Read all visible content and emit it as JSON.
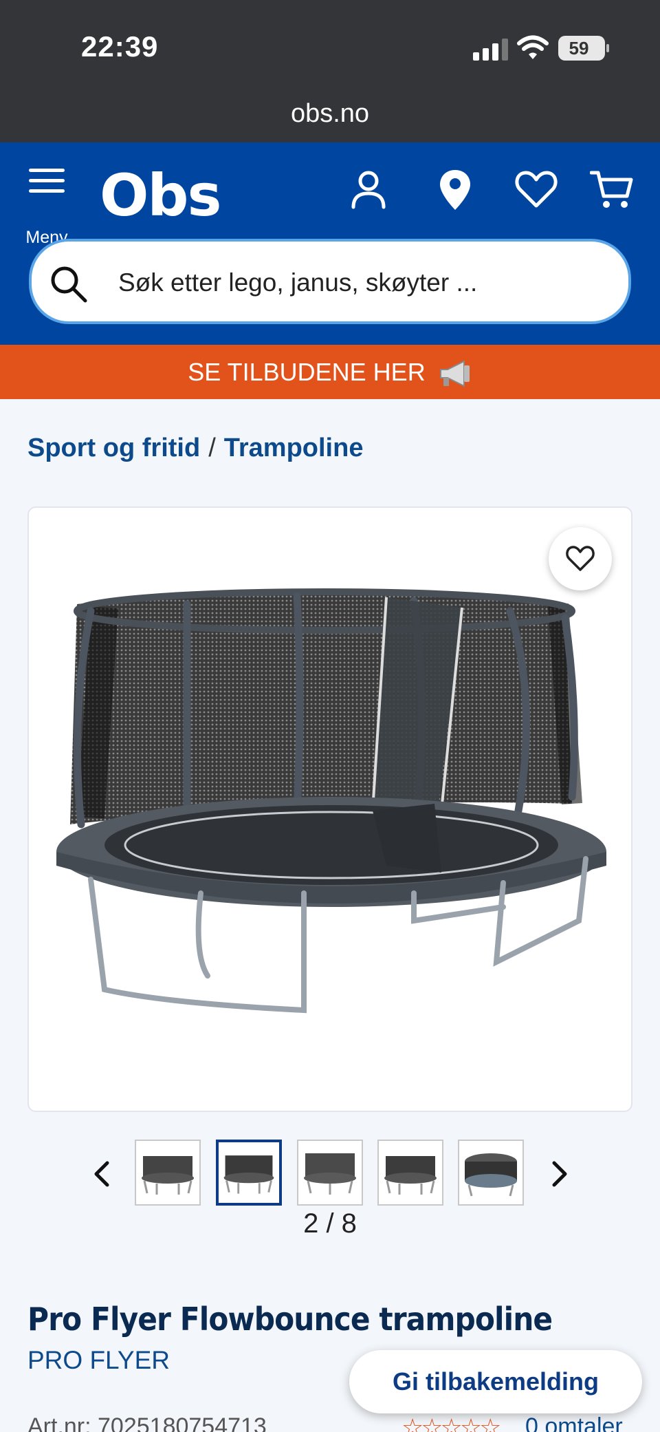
{
  "status_bar": {
    "time": "22:39",
    "battery": "59"
  },
  "browser": {
    "url": "obs.no"
  },
  "header": {
    "menu_label": "Meny",
    "logo_text": "Obs",
    "search_placeholder": "Søk etter lego, janus, skøyter ..."
  },
  "promo": {
    "text": "SE TILBUDENE HER"
  },
  "breadcrumb": {
    "items": [
      "Sport og fritid",
      "Trampoline"
    ],
    "separator": "/"
  },
  "gallery": {
    "counter": "2 / 8",
    "current": 2,
    "total": 8
  },
  "product": {
    "title": "Pro Flyer Flowbounce trampoline",
    "brand": "PRO FLYER",
    "art_nr": "Art.nr: 7025180754713",
    "rating_stars": "☆☆☆☆☆",
    "reviews": "0 omtaler"
  },
  "feedback_button": "Gi tilbakemelding",
  "colors": {
    "brand_blue": "#0046a0",
    "promo_orange": "#e2531b",
    "link_blue": "#0d4a8c"
  }
}
